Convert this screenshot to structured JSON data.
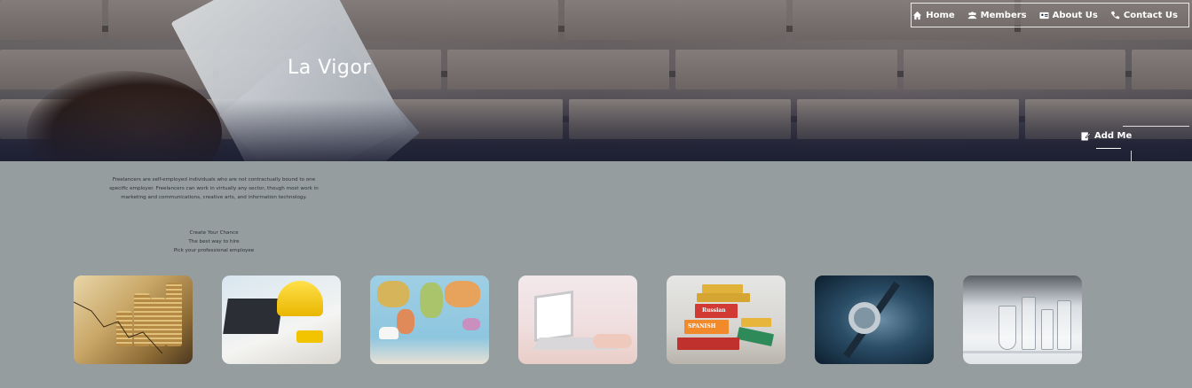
{
  "site": {
    "title": "La Vigor"
  },
  "nav": [
    {
      "label": "Home",
      "icon": "home-icon"
    },
    {
      "label": "Members",
      "icon": "users-icon"
    },
    {
      "label": "About Us",
      "icon": "id-card-icon"
    },
    {
      "label": "Contact Us",
      "icon": "phone-icon"
    }
  ],
  "hero": {
    "add_me_label": "Add Me",
    "add_me_icon": "edit-icon"
  },
  "intro": {
    "text": "Freelancers are self-employed individuals who are not contractually bound to one specific employer. Freelancers can work in virtually any sector, though most work in marketing and communications, creative arts, and information technology."
  },
  "taglines": [
    "Create Your Chance",
    "The best way to hire",
    "Pick your professional employee"
  ],
  "cards": [
    {
      "name": "finance-card",
      "picture": "coins-and-chart"
    },
    {
      "name": "engineering-card",
      "picture": "hardhat-laptop-tools"
    },
    {
      "name": "travel-card",
      "picture": "world-map-room"
    },
    {
      "name": "it-card",
      "picture": "laptop-typing"
    },
    {
      "name": "languages-card",
      "picture": "language-books",
      "book_labels": [
        "Russian",
        "SPANISH"
      ]
    },
    {
      "name": "medical-card",
      "picture": "stethoscope"
    },
    {
      "name": "science-card",
      "picture": "lab-glassware"
    }
  ],
  "colors": {
    "body_bg": "#959d9f",
    "hero_overlay": "#1e2034",
    "text": "#2e3338",
    "white": "#ffffff"
  }
}
